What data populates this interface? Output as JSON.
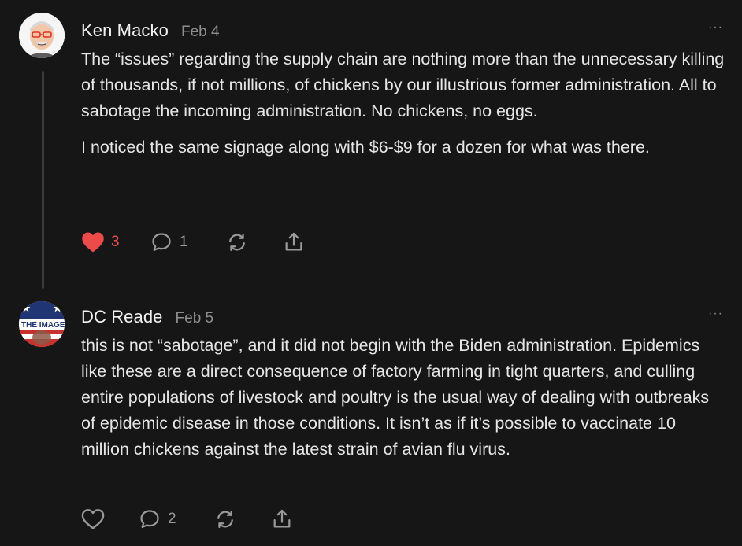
{
  "comments": [
    {
      "author": "Ken Macko",
      "date": "Feb 4",
      "more": "···",
      "paragraphs": [
        "The “issues” regarding the supply chain are nothing more than the unnecessary killing of thousands, if not millions, of chickens by our illustrious former administration. All to sabotage the incoming administration. No chickens, no eggs.",
        "I noticed the same signage along with $6-$9 for a dozen for what was there."
      ],
      "likes": "3",
      "liked": true,
      "replies": "1",
      "icons": [
        "heart-icon",
        "comment-icon",
        "restack-icon",
        "share-icon"
      ]
    },
    {
      "author": "DC Reade",
      "date": "Feb 5",
      "more": "···",
      "paragraphs": [
        "this is not “sabotage”, and it did not begin with the Biden administration. Epidemics like these are a direct consequence of factory farming in tight quarters, and culling entire populations of livestock and poultry is the usual way of dealing with outbreaks of epidemic disease in those conditions. It isn’t as if it’s possible to vaccinate 10 million chickens against the latest strain of avian flu virus."
      ],
      "avatar_text": "THE IMAGE",
      "likes": "",
      "liked": false,
      "replies": "2",
      "icons": [
        "heart-outline-icon",
        "comment-icon",
        "restack-icon",
        "share-icon"
      ]
    }
  ],
  "colors": {
    "background": "#161616",
    "like_active": "#ee4a4a",
    "muted": "#8e8e8e"
  }
}
